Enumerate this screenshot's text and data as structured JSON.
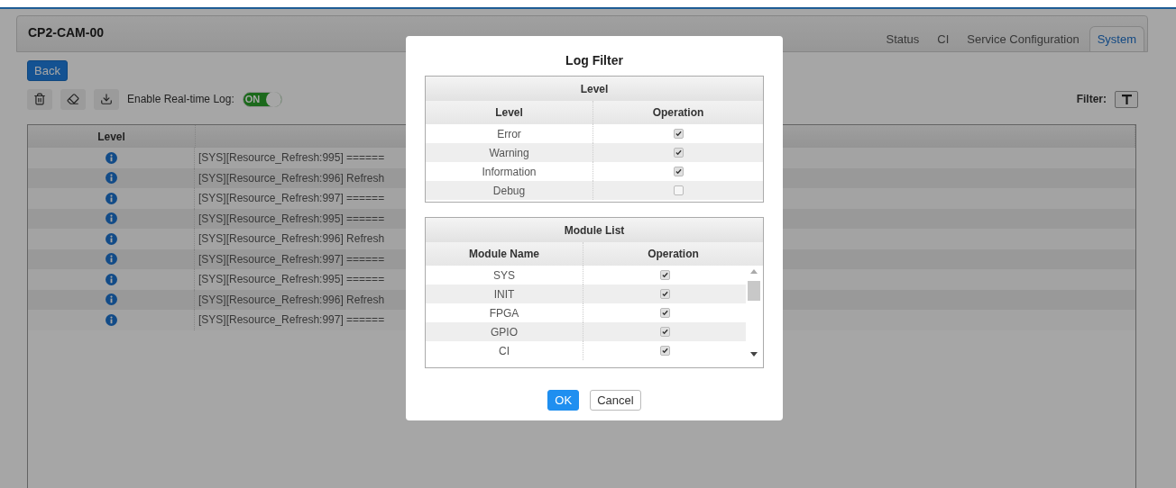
{
  "header": {
    "title": "CP2-CAM-00",
    "tabs": [
      {
        "label": "Status",
        "selected": false
      },
      {
        "label": "CI",
        "selected": false
      },
      {
        "label": "Service Configuration",
        "selected": false
      },
      {
        "label": "System",
        "selected": true
      }
    ]
  },
  "toolbar": {
    "back": "Back",
    "realtime_label": "Enable Real-time Log:",
    "realtime": {
      "label": "ON",
      "on": true
    },
    "filter_label": "Filter:"
  },
  "log_table": {
    "columns": [
      "Level"
    ],
    "rows": [
      {
        "kind": "info",
        "message": "[SYS][Resource_Refresh:995] ======"
      },
      {
        "kind": "info",
        "message": "[SYS][Resource_Refresh:996] Refresh"
      },
      {
        "kind": "info",
        "message": "[SYS][Resource_Refresh:997] ======"
      },
      {
        "kind": "info",
        "message": "[SYS][Resource_Refresh:995] ======"
      },
      {
        "kind": "info",
        "message": "[SYS][Resource_Refresh:996] Refresh"
      },
      {
        "kind": "info",
        "message": "[SYS][Resource_Refresh:997] ======"
      },
      {
        "kind": "info",
        "message": "[SYS][Resource_Refresh:995] ======"
      },
      {
        "kind": "info",
        "message": "[SYS][Resource_Refresh:996] Refresh"
      },
      {
        "kind": "info",
        "message": "[SYS][Resource_Refresh:997] ======"
      }
    ]
  },
  "dialog": {
    "title": "Log Filter",
    "level_section": {
      "title": "Level",
      "columns": [
        "Level",
        "Operation"
      ],
      "rows": [
        {
          "name": "Error",
          "checked": true
        },
        {
          "name": "Warning",
          "checked": true
        },
        {
          "name": "Information",
          "checked": true
        },
        {
          "name": "Debug",
          "checked": false
        }
      ]
    },
    "module_section": {
      "title": "Module List",
      "columns": [
        "Module Name",
        "Operation"
      ],
      "rows": [
        {
          "name": "SYS",
          "checked": true
        },
        {
          "name": "INIT",
          "checked": true
        },
        {
          "name": "FPGA",
          "checked": true
        },
        {
          "name": "GPIO",
          "checked": true
        },
        {
          "name": "CI",
          "checked": true
        }
      ]
    },
    "buttons": [
      {
        "label": "OK",
        "kind": "primary"
      },
      {
        "label": "Cancel",
        "kind": "secondary"
      }
    ]
  }
}
